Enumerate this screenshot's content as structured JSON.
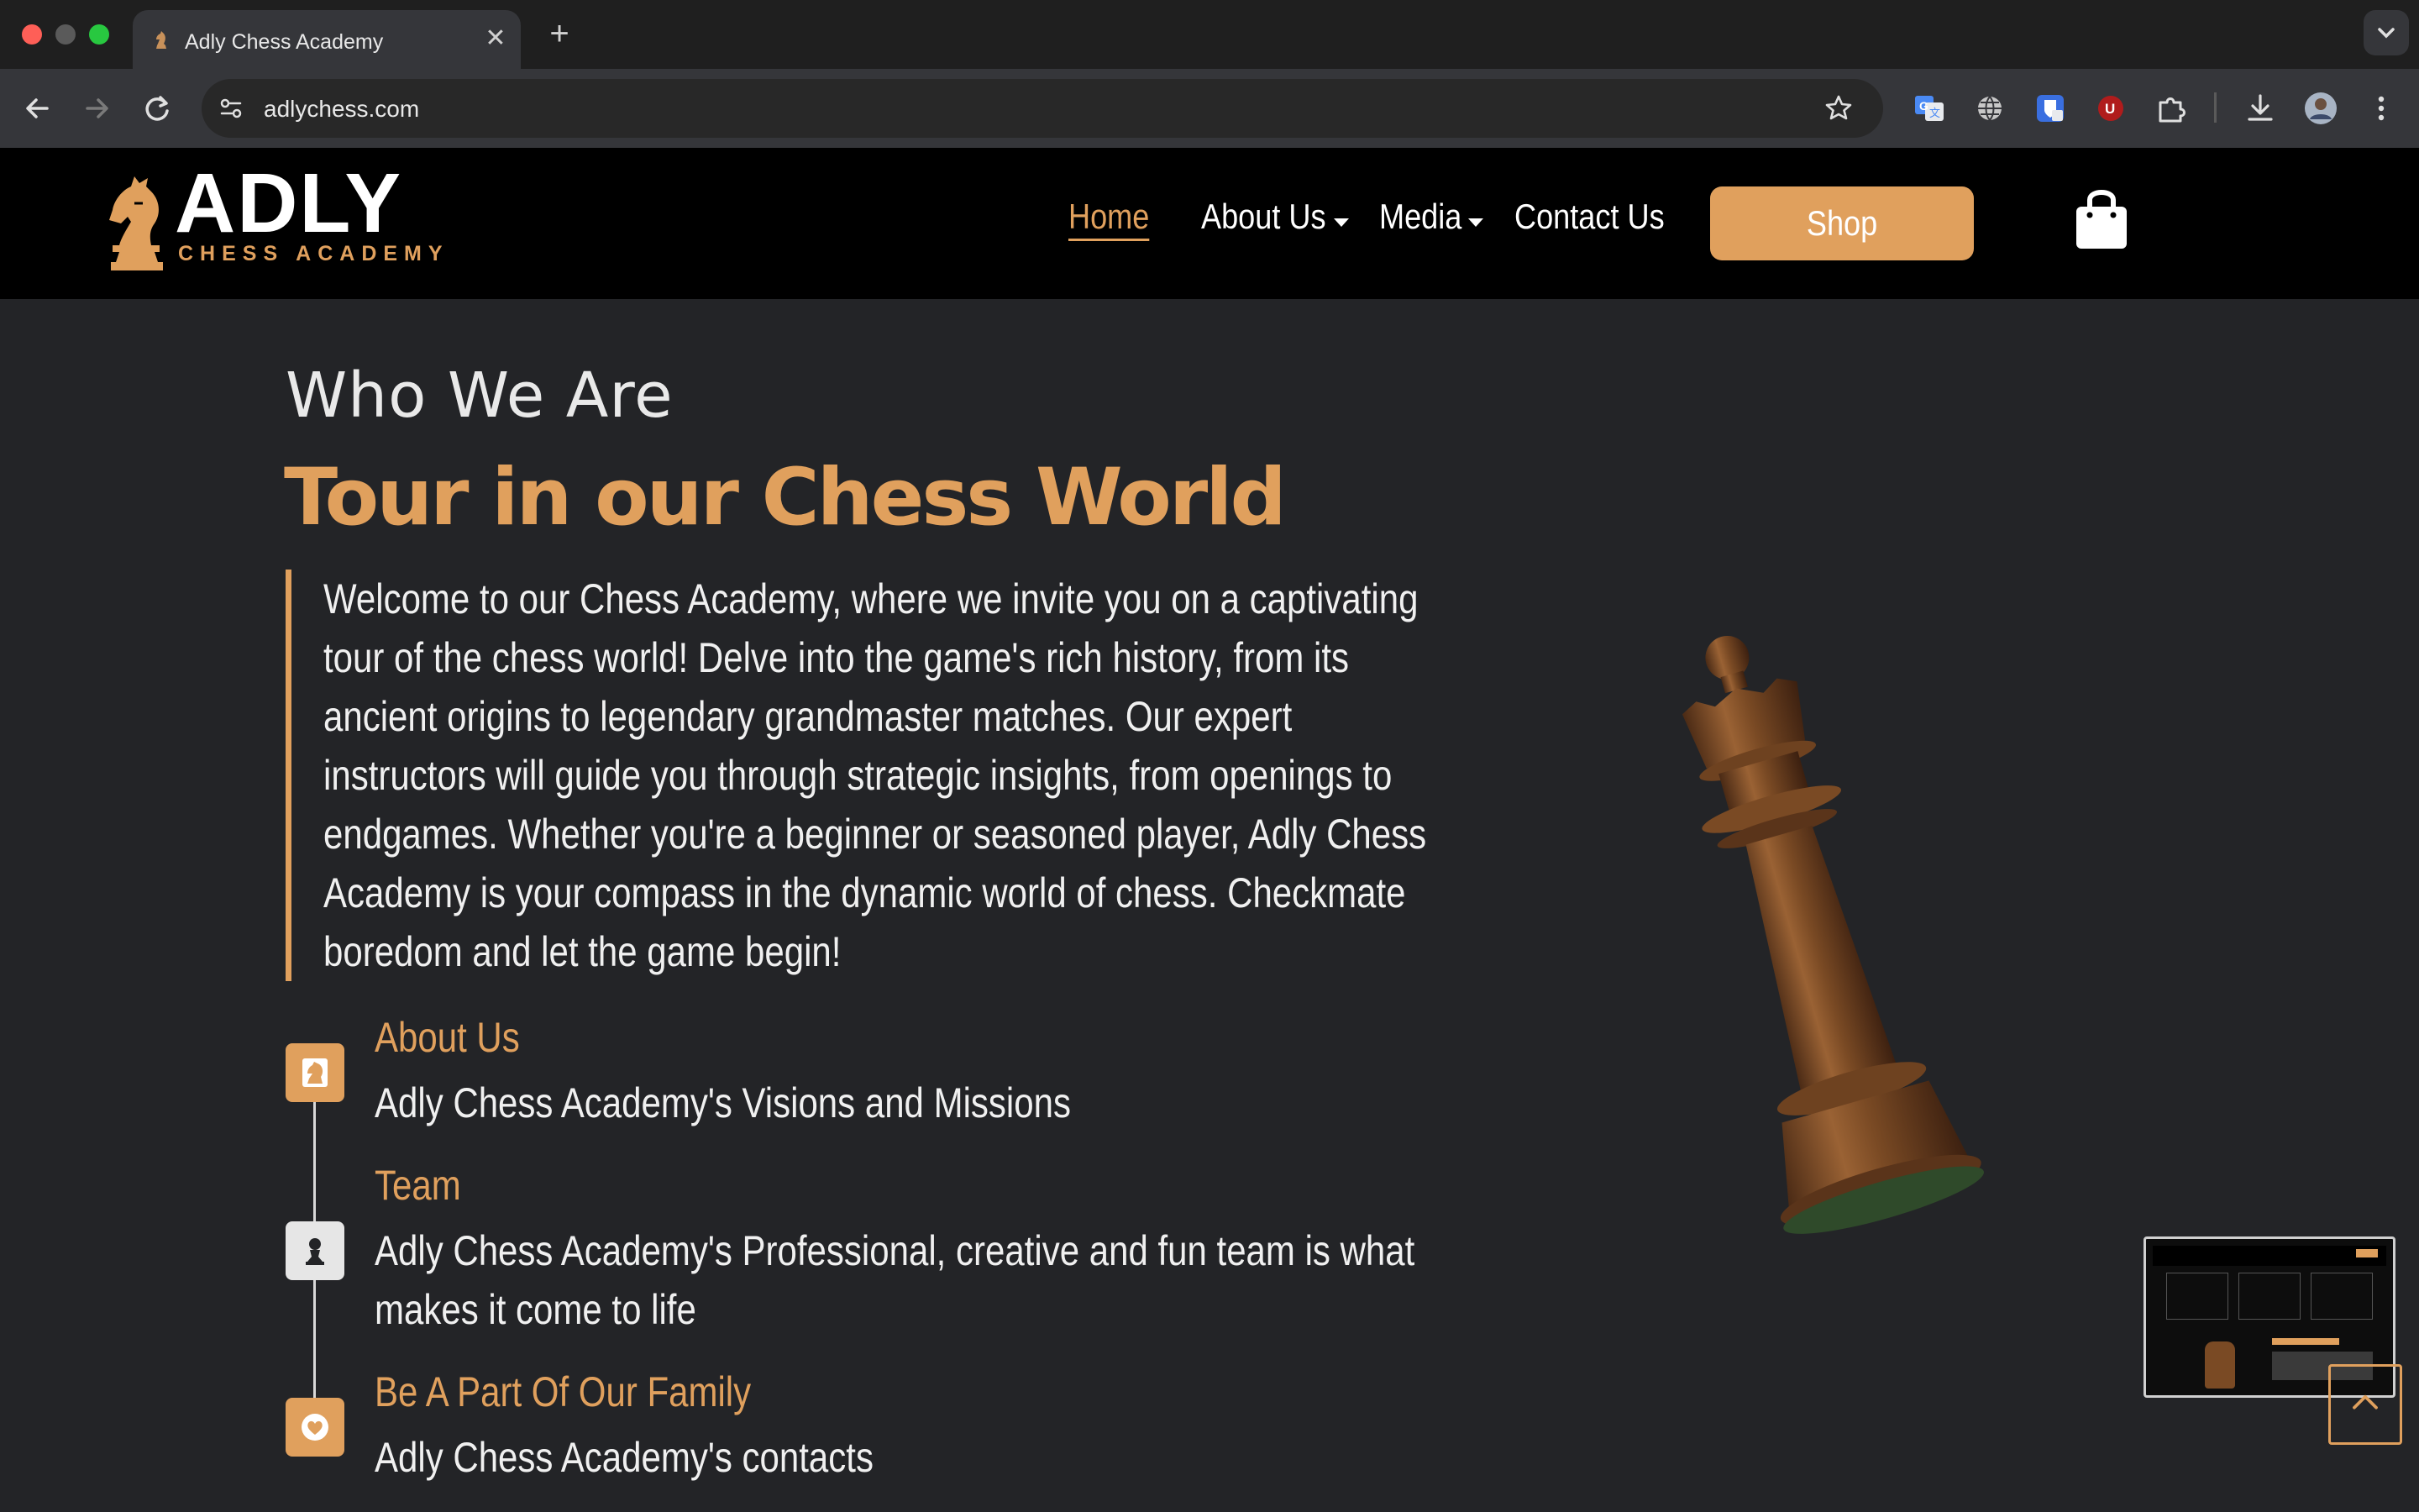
{
  "browser": {
    "tab_title": "Adly Chess Academy",
    "url": "adlychess.com",
    "close_glyph": "✕",
    "newtab_glyph": "+"
  },
  "site": {
    "logo_text": "ADLY",
    "logo_subtitle": "CHESS ACADEMY",
    "nav": {
      "home": "Home",
      "about": "About Us",
      "media": "Media",
      "contact": "Contact Us",
      "shop": "Shop"
    }
  },
  "hero": {
    "eyebrow": "Who We Are",
    "headline": "Tour in our Chess World",
    "intro": "Welcome to our Chess Academy, where we invite you on a captivating tour of the chess world! Delve into the game's rich history, from its ancient origins to legendary grandmaster matches. Our expert instructors will guide you through strategic insights, from openings to endgames. Whether you're a beginner or seasoned player, Adly Chess Academy is your compass in the dynamic world of chess. Checkmate boredom and let the game begin!"
  },
  "timeline": [
    {
      "title": "About Us",
      "desc": "Adly Chess Academy's Visions and Missions",
      "icon": "knight-icon"
    },
    {
      "title": "Team",
      "desc": "Adly Chess Academy's Professional, creative and fun team is what makes it come to life",
      "icon": "pawn-icon"
    },
    {
      "title": "Be A Part Of Our Family",
      "desc": "Adly Chess Academy's contacts",
      "icon": "heart-icon"
    }
  ],
  "colors": {
    "accent": "#e0a05d",
    "page_bg": "#232427",
    "header_bg": "#000000"
  }
}
